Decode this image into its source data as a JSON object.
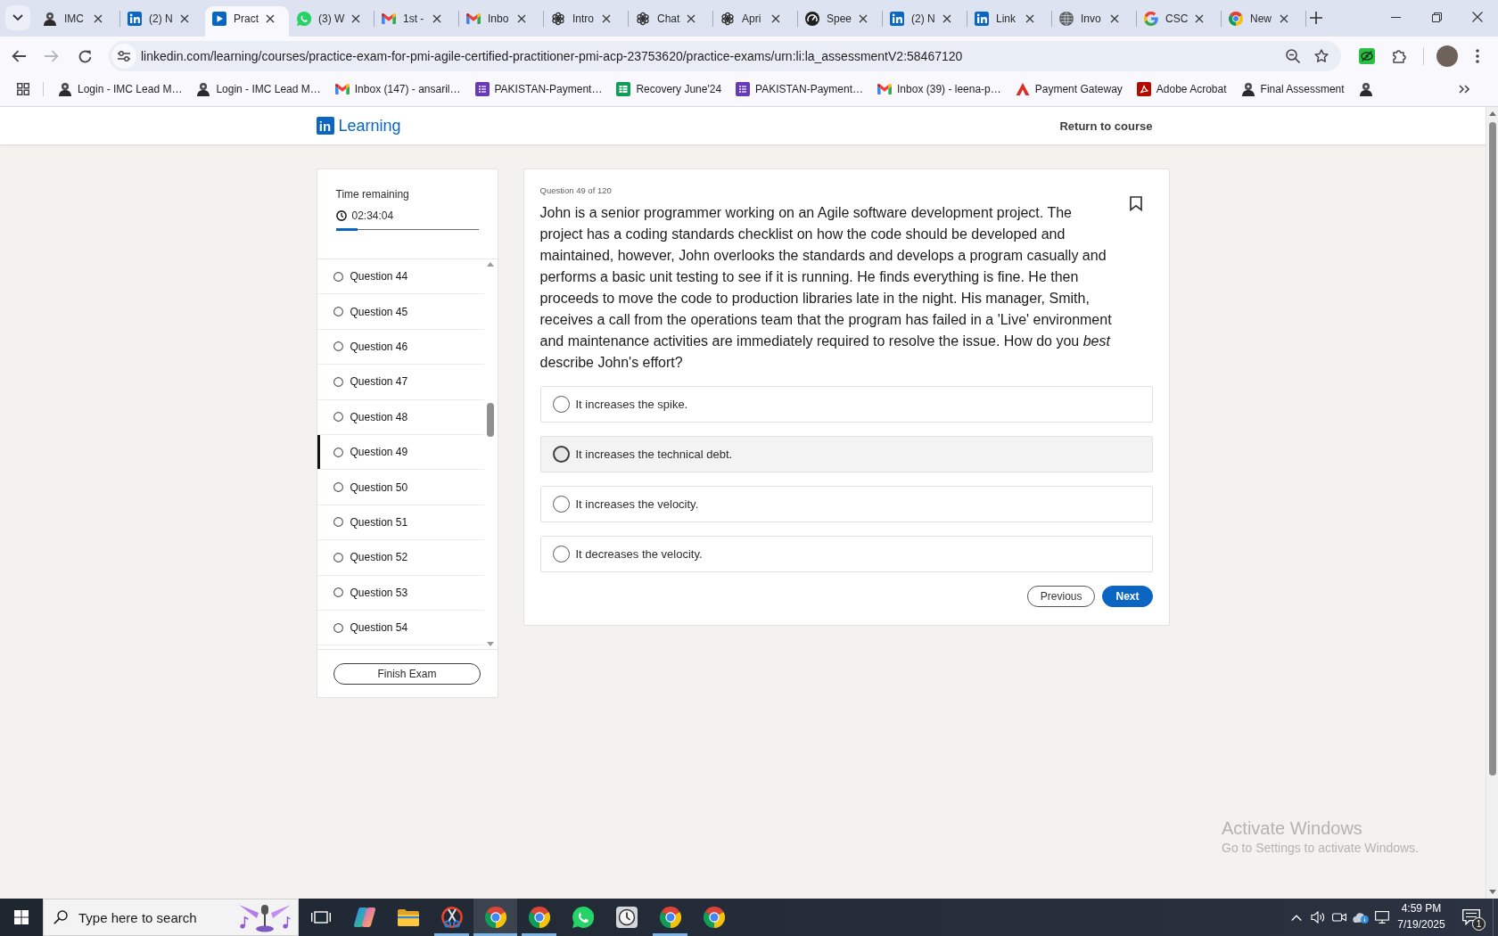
{
  "browser": {
    "tabs": [
      {
        "title": "IMC",
        "kind": "imc",
        "selected": false
      },
      {
        "title": "(2) N",
        "kind": "linkedin",
        "selected": false
      },
      {
        "title": "Pract",
        "kind": "learning",
        "selected": true
      },
      {
        "title": "(3) W",
        "kind": "whatsapp",
        "selected": false
      },
      {
        "title": "1st -",
        "kind": "gmail",
        "selected": false
      },
      {
        "title": "Inbo",
        "kind": "gmail",
        "selected": false
      },
      {
        "title": "Intro",
        "kind": "openai",
        "selected": false
      },
      {
        "title": "Chat",
        "kind": "openai",
        "selected": false
      },
      {
        "title": "Apri",
        "kind": "openai",
        "selected": false
      },
      {
        "title": "Spee",
        "kind": "gauge",
        "selected": false
      },
      {
        "title": "(2) N",
        "kind": "linkedin",
        "selected": false
      },
      {
        "title": "Link",
        "kind": "linkedin",
        "selected": false
      },
      {
        "title": "Invo",
        "kind": "globe",
        "selected": false
      },
      {
        "title": "CSC",
        "kind": "google",
        "selected": false
      },
      {
        "title": "New",
        "kind": "chrome",
        "selected": false
      }
    ],
    "forward_button": {
      "disabled": true
    },
    "address_bar": {
      "url": "linkedin.com/learning/courses/practice-exam-for-pmi-agile-certified-practitioner-pmi-acp-23753620/practice-exams/urn:li:la_assessmentV2:58467120"
    },
    "bookmarks": [
      {
        "title": "Login - IMC Lead M…",
        "kind": "imc"
      },
      {
        "title": "Login - IMC Lead M…",
        "kind": "imc"
      },
      {
        "title": "Inbox (147) - ansaril…",
        "kind": "gmail"
      },
      {
        "title": "PAKISTAN-Payment…",
        "kind": "form"
      },
      {
        "title": "Recovery June'24",
        "kind": "sheet"
      },
      {
        "title": "PAKISTAN-Payment…",
        "kind": "form"
      },
      {
        "title": "Inbox (39) - leena-p…",
        "kind": "gmail"
      },
      {
        "title": "Payment Gateway",
        "kind": "triangle"
      },
      {
        "title": "Adobe Acrobat",
        "kind": "pdf"
      },
      {
        "title": "Final Assessment",
        "kind": "imc"
      },
      {
        "kind": "imc"
      }
    ]
  },
  "page": {
    "header": {
      "logo_mark": "in",
      "logo_text": "Learning",
      "return_link": "Return to course"
    },
    "timer": {
      "label": "Time remaining",
      "value": "02:34:04",
      "level": 0.15
    },
    "question_nav": {
      "items": [
        {
          "label": "Question 44",
          "selected": false,
          "answered": false
        },
        {
          "label": "Question 45",
          "selected": false,
          "answered": false
        },
        {
          "label": "Question 46",
          "selected": false,
          "answered": false
        },
        {
          "label": "Question 47",
          "selected": false,
          "answered": false
        },
        {
          "label": "Question 48",
          "selected": false,
          "answered": false
        },
        {
          "label": "Question 49",
          "selected": true,
          "answered": false
        },
        {
          "label": "Question 50",
          "selected": false,
          "answered": false
        },
        {
          "label": "Question 51",
          "selected": false,
          "answered": false
        },
        {
          "label": "Question 52",
          "selected": false,
          "answered": false
        },
        {
          "label": "Question 53",
          "selected": false,
          "answered": false
        },
        {
          "label": "Question 54",
          "selected": false,
          "answered": false
        }
      ],
      "finish_button": "Finish Exam"
    },
    "question": {
      "counter": "Question 49 of 120",
      "text": "John is a senior programmer working on an Agile software development project. The project has a coding standards checklist on how the code should be developed and maintained, however, John overlooks the standards and develops a program casually and performs a basic unit testing to see if it is running. He finds everything is fine. He then proceeds to move the code to production libraries late in the night. His manager, Smith, receives a call from the operations team that the program has failed in a 'Live' environment and maintenance activities are immediately required to resolve the issue. How do you *best* describe John's effort?",
      "bookmarked": false,
      "options": [
        {
          "text": "It increases the spike.",
          "selected": false,
          "hovered": false
        },
        {
          "text": "It increases the technical debt.",
          "selected": false,
          "hovered": true
        },
        {
          "text": "It increases the velocity.",
          "selected": false,
          "hovered": false
        },
        {
          "text": "It decreases the velocity.",
          "selected": false,
          "hovered": false
        }
      ],
      "buttons": [
        {
          "label": "Previous",
          "kind": "secondary"
        },
        {
          "label": "Next",
          "kind": "primary"
        }
      ]
    }
  },
  "activation_notice": {
    "title": "Activate Windows",
    "text": "Go to Settings to activate Windows."
  },
  "taskbar": {
    "search": {
      "placeholder": "Type here to search"
    },
    "apps": [
      {
        "kind": "task-view",
        "running": false,
        "selected": false
      },
      {
        "kind": "copilot",
        "running": false,
        "selected": false
      },
      {
        "kind": "file-explorer",
        "running": false,
        "selected": false
      },
      {
        "kind": "snipping-tool",
        "running": true,
        "selected": false
      },
      {
        "kind": "chrome",
        "running": true,
        "selected": true
      },
      {
        "kind": "chrome",
        "running": true,
        "selected": false
      },
      {
        "kind": "whatsapp",
        "running": false,
        "selected": false
      },
      {
        "kind": "clock",
        "running": false,
        "selected": false
      },
      {
        "kind": "chrome",
        "running": true,
        "selected": false
      },
      {
        "kind": "chrome",
        "running": false,
        "selected": false
      }
    ],
    "clock": {
      "time": "4:59 PM",
      "date": "7/19/2025"
    },
    "notifications": {
      "count": "1"
    }
  }
}
